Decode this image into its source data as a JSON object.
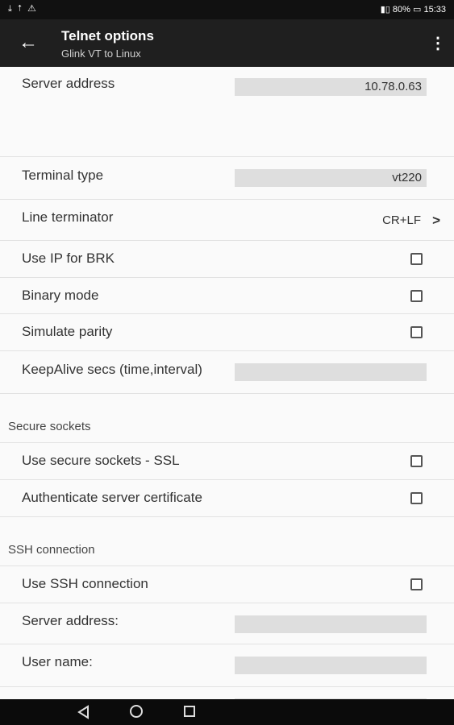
{
  "status_bar": {
    "left_icons": "⤓ ⭡ ⚠",
    "right_text": "80%",
    "time": "15:33"
  },
  "app_bar": {
    "title": "Telnet options",
    "subtitle": "Glink VT to Linux"
  },
  "rows": {
    "server_address": {
      "label": "Server address",
      "value": "10.78.0.63"
    },
    "terminal_type": {
      "label": "Terminal type",
      "value": "vt220"
    },
    "line_terminator": {
      "label": "Line terminator",
      "value": "CR+LF"
    },
    "use_ip_for_brk": {
      "label": "Use IP for BRK"
    },
    "binary_mode": {
      "label": "Binary mode"
    },
    "simulate_parity": {
      "label": "Simulate parity"
    },
    "keepalive": {
      "label": "KeepAlive secs (time,interval)",
      "value": ""
    }
  },
  "sections": {
    "secure_sockets": {
      "header": "Secure sockets",
      "use_ssl": "Use secure sockets - SSL",
      "auth_cert": "Authenticate server certificate"
    },
    "ssh": {
      "header": "SSH connection",
      "use_ssh": "Use SSH connection",
      "server_address": "Server address:",
      "user_name": "User name:"
    }
  }
}
